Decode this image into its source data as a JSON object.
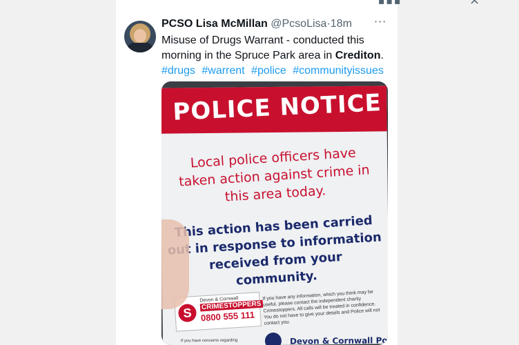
{
  "tweet": {
    "author": {
      "name": "PCSO Lisa McMillan",
      "handle": "@PcsoLisa",
      "separator": "·",
      "time": "18m"
    },
    "text_main": "Misuse of Drugs Warrant - conducted this morning in the Spruce Park area in ",
    "text_bold": "Crediton",
    "text_end": ".",
    "hashtags": [
      "#drugs",
      "#warrent",
      "#police",
      "#communityissues"
    ],
    "more_icon": "more-icon"
  },
  "notice": {
    "title": "POLICE NOTICE",
    "red_message": "Local police officers have taken action against crime in this area today.",
    "blue_message": "This action has been carried out in response to information received from your community.",
    "crimestoppers": {
      "org": "Devon & Cornwall",
      "name": "CRIMESTOPPERS",
      "phone": "0800 555 111"
    },
    "fine_print": "If you have any information, which you think may be useful, please contact the independent charity Crimestoppers. All calls will be treated in confidence. You do not have to give your details and Police will not contact you.",
    "bottom_left": "If you have concerns regarding",
    "footer": "Devon & Cornwall Poli"
  },
  "colors": {
    "police_red": "#c8102e",
    "police_blue": "#1b2a6b",
    "link_blue": "#1d9bf0"
  }
}
